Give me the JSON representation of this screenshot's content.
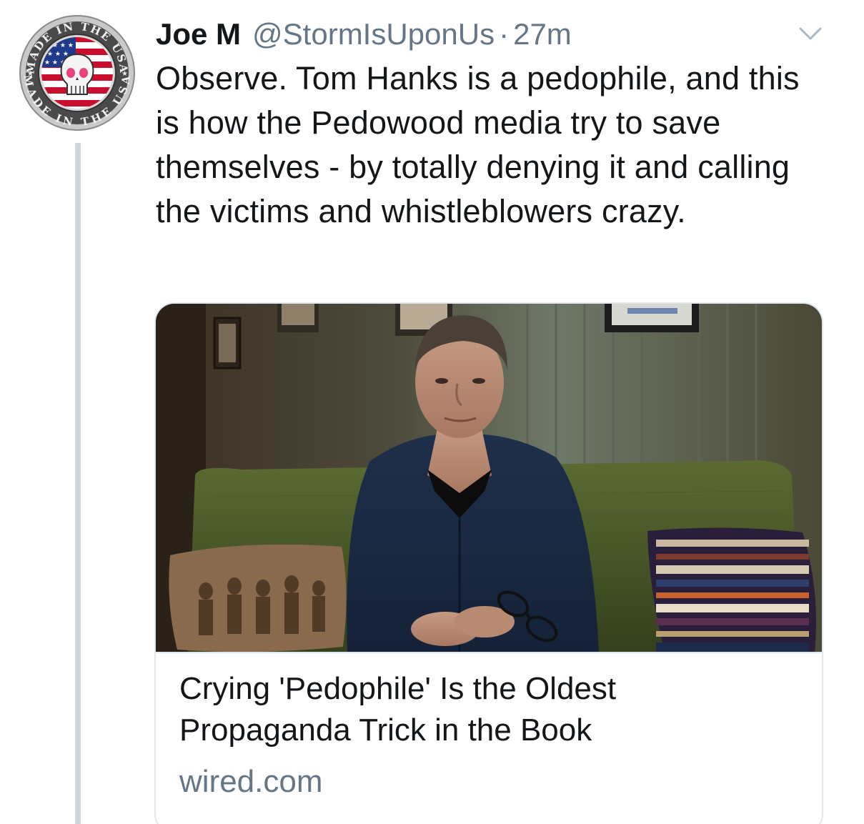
{
  "tweet": {
    "author": {
      "display_name": "Joe M",
      "handle": "@StormIsUponUs",
      "avatar_badge": {
        "top_text": "MADE IN THE USA",
        "bottom_text": "MADE IN THE USA"
      }
    },
    "separator": "·",
    "timestamp": "27m",
    "menu_icon": "chevron-down-icon",
    "text": "Observe. Tom Hanks is a pedophile, and this is how the Pedowood media try to save themselves - by totally denying it and calling the victims and whistleblowers crazy.",
    "link_card": {
      "title": "Crying 'Pedophile' Is the Oldest Propaganda Trick in the Book",
      "domain": "wired.com"
    }
  },
  "colors": {
    "text_primary": "#14171a",
    "text_secondary": "#657786",
    "border": "#e1e8ed",
    "thread_line": "#ccd6dd"
  }
}
